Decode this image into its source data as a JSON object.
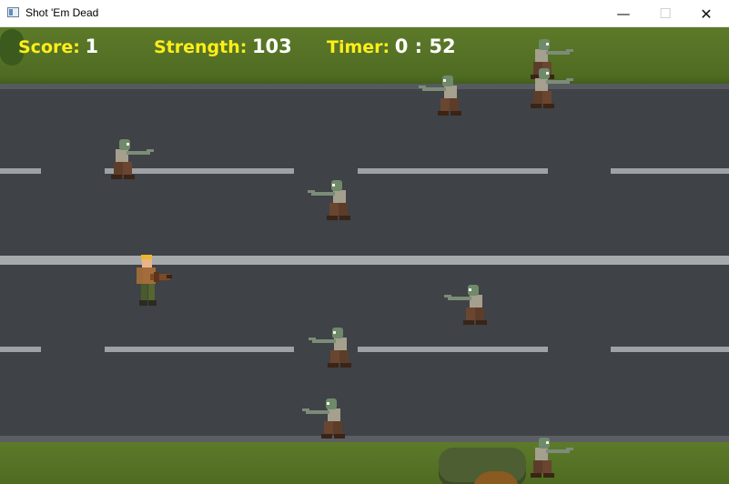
{
  "window": {
    "title": "Shot 'Em Dead",
    "app_icon": "window-app-icon",
    "minimize_glyph": "—",
    "maximize_glyph": "☐",
    "close_glyph": "✕"
  },
  "hud": {
    "score_label": "Score:",
    "score_value": "1",
    "strength_label": "Strength:",
    "strength_value": "103",
    "timer_label": "Timer:",
    "timer_value": "0 : 52"
  },
  "colors": {
    "hud_label": "#ffee1a",
    "hud_value": "#ffffff",
    "grass": "#55722a",
    "road": "#3f4246",
    "lane_marking": "#9ea2a6"
  },
  "entities": {
    "player": "soldier-with-gun",
    "zombie_count": 10
  }
}
